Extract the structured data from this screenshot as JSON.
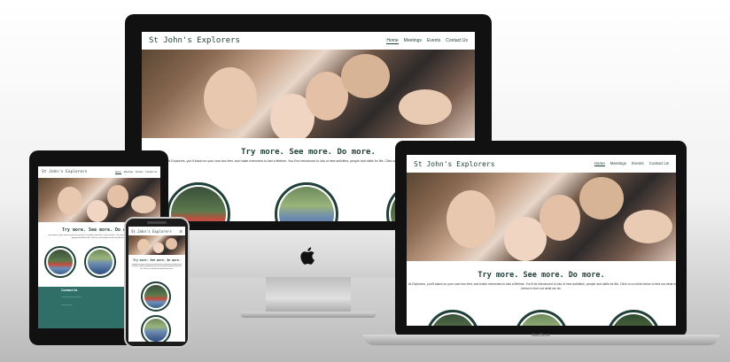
{
  "site": {
    "brand": "St John's Explorers",
    "nav": [
      "Home",
      "Meetings",
      "Events",
      "Contact Us"
    ],
    "tagline": "Try more. See more. Do more.",
    "intro_line1": "At Explorers, you'll stand on your own two feet, and make memories to last a lifetime. You'll be introduced to lots of new activities, people and skills for life. Click on a circle below to find out what we do.",
    "intro_line2": "below to find out what we do."
  },
  "devices": {
    "laptop_label": "MacBook",
    "imac_logo": "apple-logo"
  },
  "ipad_footer": {
    "title": "Contact Us",
    "line1": "—————————",
    "line2": "—————"
  },
  "colors": {
    "brand_dark": "#1f3f38",
    "footer_teal": "#2f6f68"
  }
}
